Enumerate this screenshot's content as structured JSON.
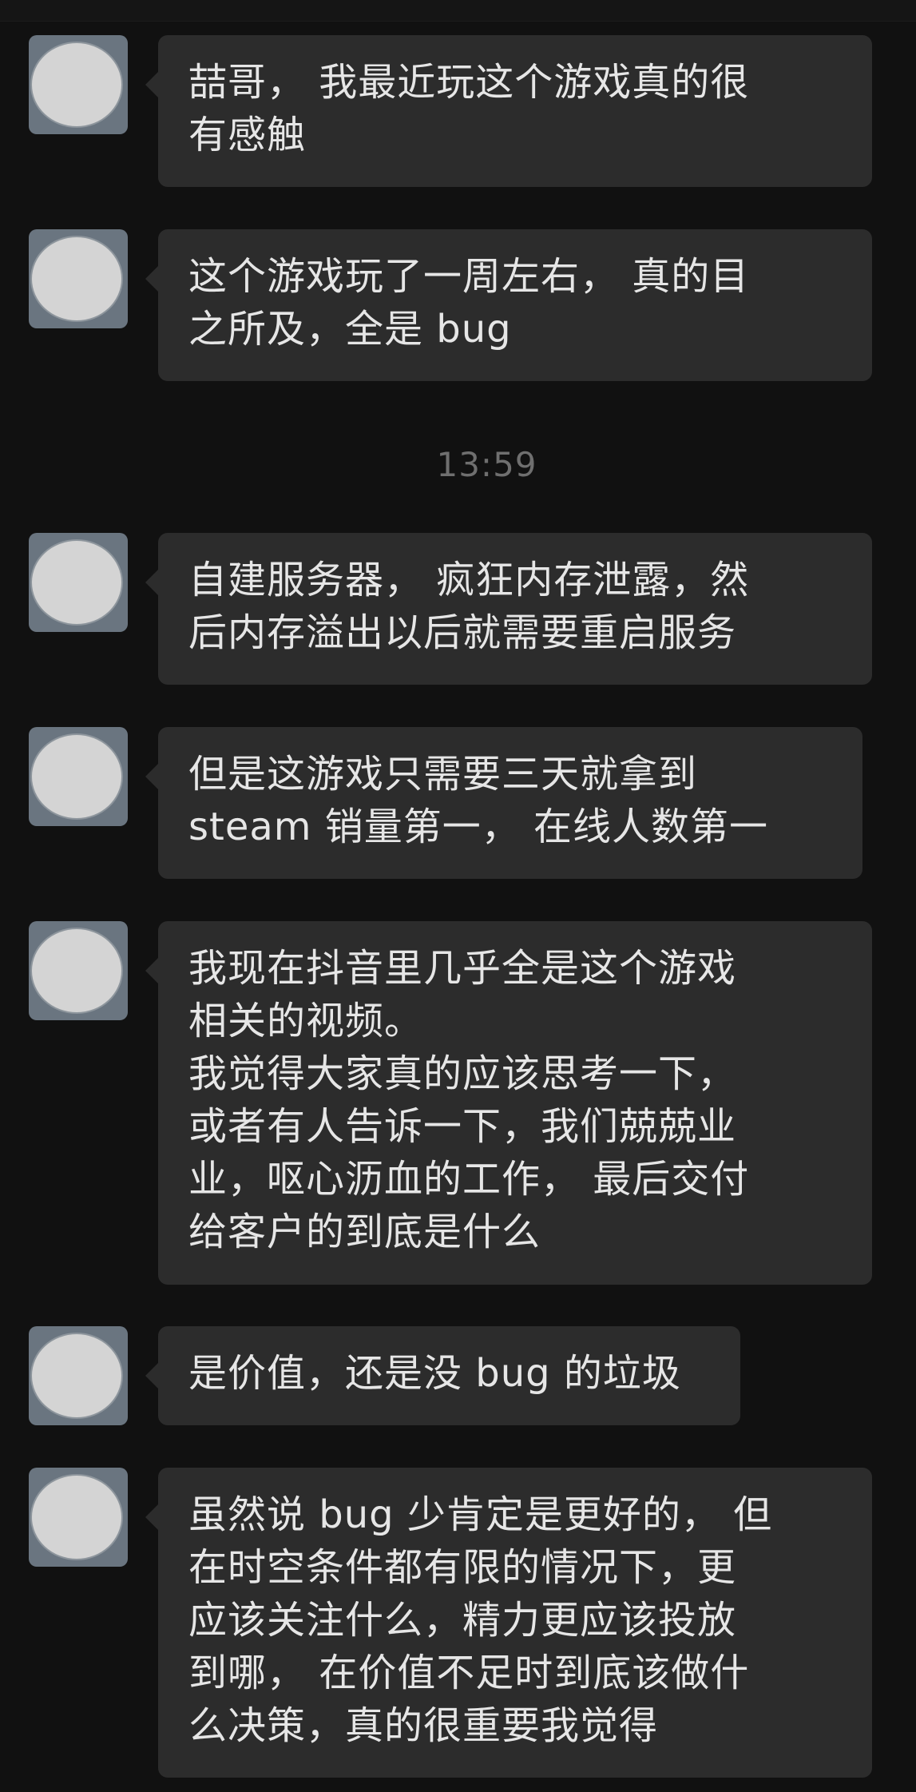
{
  "chat": {
    "timestamp": "13:59",
    "messages": [
      {
        "text": "喆哥， 我最近玩这个游戏真的很\n有感触"
      },
      {
        "text": "这个游戏玩了一周左右， 真的目\n之所及，全是 bug"
      },
      {
        "text": "自建服务器， 疯狂内存泄露，然\n后内存溢出以后就需要重启服务"
      },
      {
        "text": "但是这游戏只需要三天就拿到\nsteam 销量第一， 在线人数第一"
      },
      {
        "text": "我现在抖音里几乎全是这个游戏\n相关的视频。\n我觉得大家真的应该思考一下，\n或者有人告诉一下，我们兢兢业\n业，呕心沥血的工作， 最后交付\n给客户的到底是什么"
      },
      {
        "text": "是价值，还是没 bug 的垃圾"
      },
      {
        "text": "虽然说 bug 少肯定是更好的， 但\n在时空条件都有限的情况下，更\n应该关注什么，精力更应该投放\n到哪， 在价值不足时到底该做什\n么决策，真的很重要我觉得"
      }
    ]
  }
}
